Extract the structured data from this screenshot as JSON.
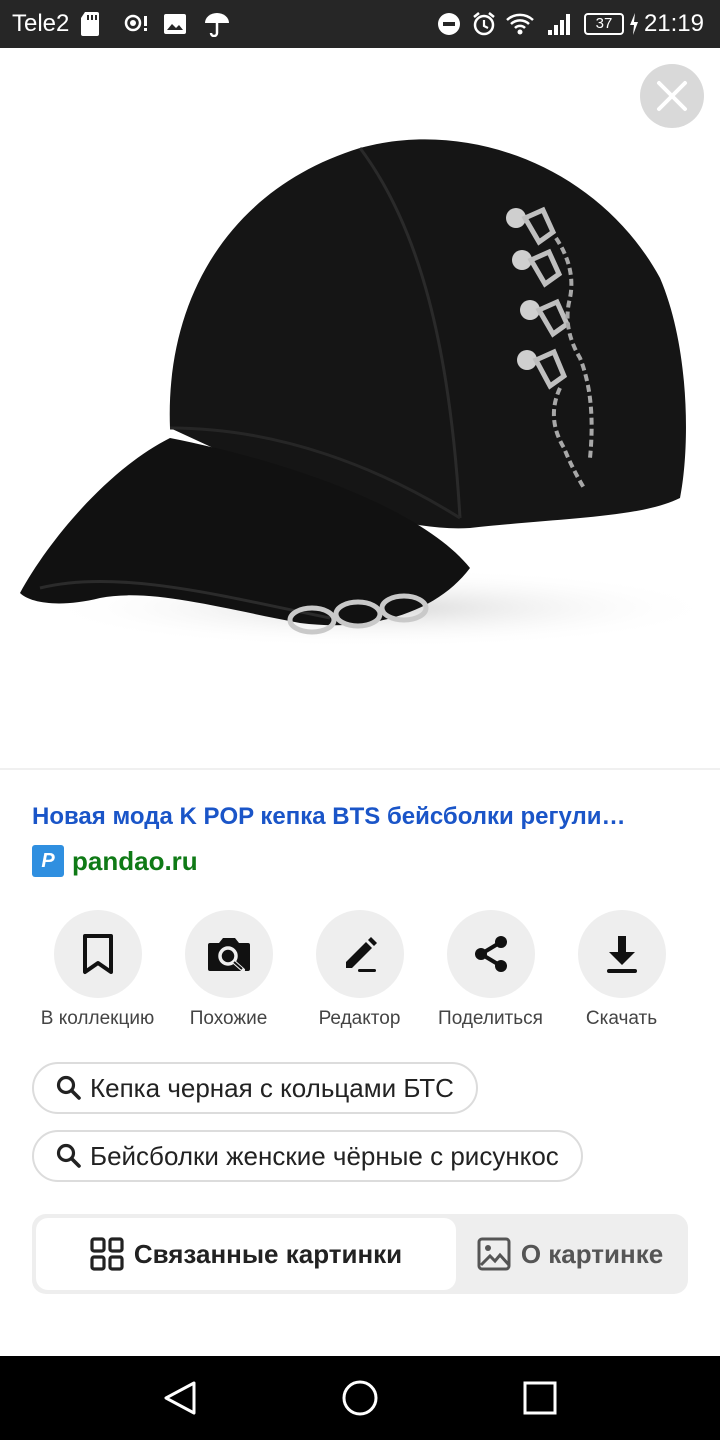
{
  "status_bar": {
    "carrier": "Tele2",
    "battery": "37",
    "time": "21:19",
    "icons": [
      "sd-card-icon",
      "hotspot-icon",
      "image-icon",
      "umbrella-icon",
      "dnd-icon",
      "alarm-icon",
      "wifi-icon",
      "signal-icon",
      "battery-icon",
      "charging-icon"
    ]
  },
  "image": {
    "description_icon": "baseball-cap-photo"
  },
  "result": {
    "title": "Новая мода K POP кепка BTS бейсболки регули…",
    "source": "pandao.ru",
    "source_logo_letter": "P"
  },
  "actions": [
    {
      "label": "В коллекцию",
      "icon": "bookmark-icon"
    },
    {
      "label": "Похожие",
      "icon": "camera-search-icon"
    },
    {
      "label": "Редактор",
      "icon": "pencil-icon"
    },
    {
      "label": "Поделиться",
      "icon": "share-icon"
    },
    {
      "label": "Скачать",
      "icon": "download-icon"
    }
  ],
  "suggestions": [
    "Кепка черная с кольцами БТС",
    "Бейсболки женские чёрные с рисункос"
  ],
  "tabs": {
    "related": "Связанные картинки",
    "about": "О картинке",
    "active": "related"
  },
  "colors": {
    "title_link": "#1a55c8",
    "source_link": "#0f7a16",
    "status_bar": "#262626"
  }
}
